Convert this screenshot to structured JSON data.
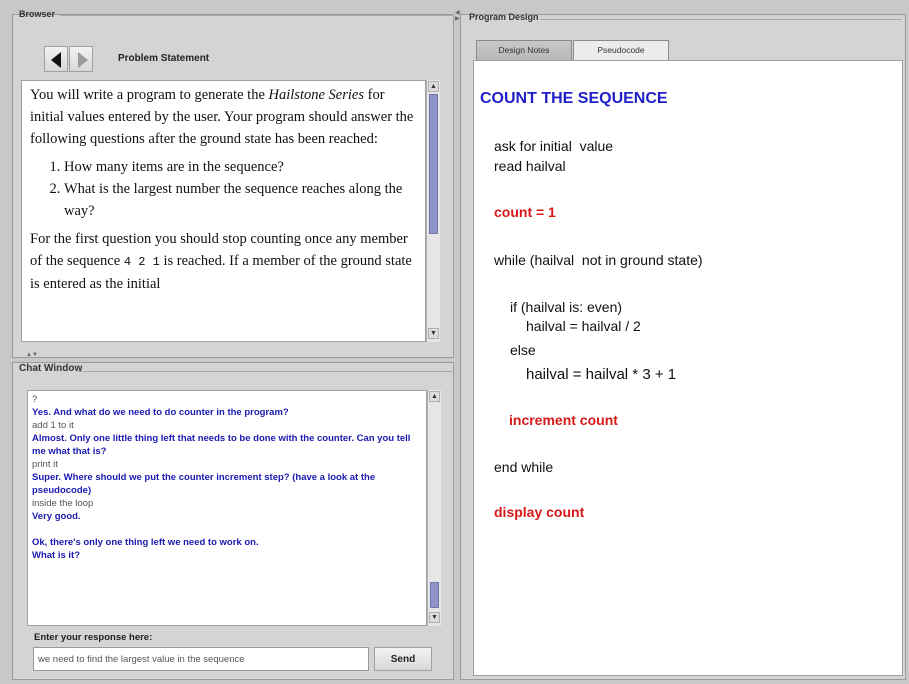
{
  "browser": {
    "title": "Browser",
    "tab_label": "Problem Statement",
    "problem": {
      "intro_before": "You will write a program to generate the ",
      "intro_italic": "Hailstone Series",
      "intro_after": " for initial values entered by the user. Your program should answer the following questions after the ground state has been reached:",
      "questions": [
        "How many items are in the sequence?",
        "What is the largest number the sequence reaches along the way?"
      ],
      "para2_before": "For the first question you should stop counting once any member of the sequence ",
      "para2_seq": "4 2 1",
      "para2_after": " is reached. If a member of the ground state is entered as the initial"
    }
  },
  "chat": {
    "title": "Chat Window",
    "messages": [
      {
        "role": "student",
        "text": "?"
      },
      {
        "role": "tutor",
        "text": "Yes. And what do we need to do counter in the program?"
      },
      {
        "role": "student",
        "text": "add 1 to it"
      },
      {
        "role": "tutor",
        "text": "Almost. Only one little thing left that needs to be done with the counter. Can you tell me what that is?"
      },
      {
        "role": "student",
        "text": "print it"
      },
      {
        "role": "tutor",
        "text": "Super. Where should we put the counter increment step? (have a look at the pseudocode)"
      },
      {
        "role": "student",
        "text": "inside the loop"
      },
      {
        "role": "tutor",
        "text": "Very good."
      },
      {
        "role": "spacer",
        "text": ""
      },
      {
        "role": "tutor",
        "text": "Ok, there's only one thing left we need to work on."
      },
      {
        "role": "tutor",
        "text": "What is it?"
      }
    ],
    "input_label": "Enter your response here:",
    "input_value": "we need to find the largest value in the sequence",
    "send_label": "Send"
  },
  "design": {
    "title": "Program Design",
    "tabs": [
      "Design Notes",
      "Pseudocode"
    ],
    "heading": "COUNT THE SEQUENCE",
    "lines": {
      "l1": "ask for initial  value",
      "l2": "read hailval",
      "l3": "count = 1",
      "l4": "while (hailval  not in ground state)",
      "l5": "if (hailval is: even)",
      "l6": "hailval = hailval / 2",
      "l7": "else",
      "l8": "hailval = hailval * 3 + 1",
      "l9": "increment count",
      "l10": "end while",
      "l11": "display count"
    }
  },
  "colors": {
    "heading_blue": "#2020c8",
    "accent_red": "#d81818",
    "tutor_blue": "#1a1ab0",
    "scroll_thumb": "#8f93c8"
  }
}
